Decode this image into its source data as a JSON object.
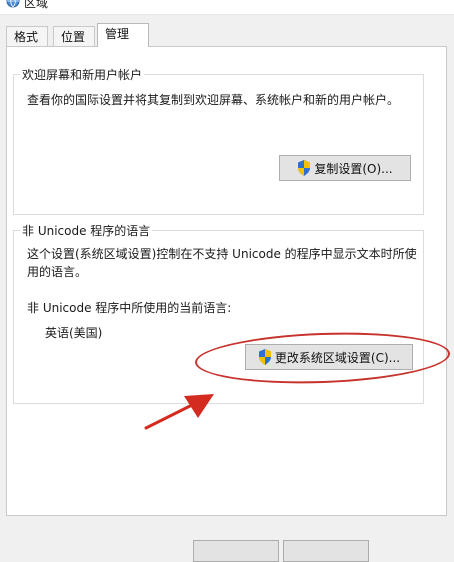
{
  "window": {
    "title": "区域",
    "icon": "globe-icon"
  },
  "tabs": [
    {
      "label": "格式"
    },
    {
      "label": "位置"
    },
    {
      "label": "管理",
      "active": true
    }
  ],
  "welcome_group": {
    "title": "欢迎屏幕和新用户帐户",
    "description": "查看你的国际设置并将其复制到欢迎屏幕、系统帐户和新的用户帐户。",
    "button_label": "复制设置(O)..."
  },
  "unicode_group": {
    "title": "非 Unicode 程序的语言",
    "description_line1": "这个设置(系统区域设置)控制在不支持 Unicode 的程序中显示文本时所使",
    "description_line2": "用的语言。",
    "current_label": "非 Unicode 程序中所使用的当前语言:",
    "current_value": "英语(美国)",
    "button_label": "更改系统区域设置(C)..."
  },
  "annotation": {
    "ellipse_color": "#c7322c",
    "arrow_color": "#d42b21"
  },
  "colors": {
    "shield_blue": "#2f6fcf",
    "shield_yellow": "#f2c200"
  }
}
